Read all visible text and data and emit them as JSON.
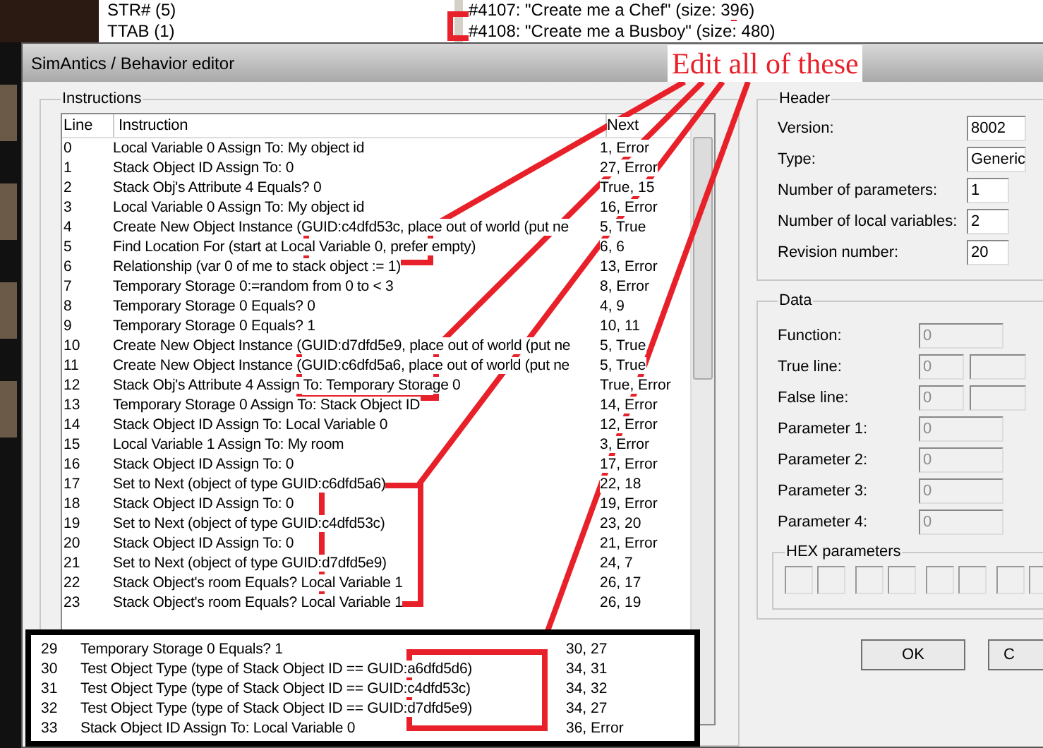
{
  "background_window": {
    "resource_list": [
      "STR# (5)",
      "TTAB (1)"
    ],
    "string_list": [
      "#4107: \"Create me a Chef\" (size: 396)",
      "#4108: \"Create me a Busboy\" (size: 480)"
    ]
  },
  "dialog": {
    "title": "SimAntics / Behavior editor"
  },
  "instructions": {
    "title": "Instructions",
    "columns": [
      "Line",
      "Instruction",
      "Next"
    ],
    "rows": [
      {
        "line": "0",
        "instruction": "Local Variable 0 Assign To: My object id",
        "next": "1, Error"
      },
      {
        "line": "1",
        "instruction": "Stack Object ID Assign To: 0",
        "next": "27, Error"
      },
      {
        "line": "2",
        "instruction": "Stack Obj's Attribute 4 Equals? 0",
        "next": "True, 15"
      },
      {
        "line": "3",
        "instruction": "Local Variable 0 Assign To: My object id",
        "next": "16, Error"
      },
      {
        "line": "4",
        "instruction": "Create New Object Instance (GUID:c4dfd53c, place out of world (put ne",
        "next": "5, True"
      },
      {
        "line": "5",
        "instruction": "Find Location For (start at Local Variable 0, prefer empty)",
        "next": "6, 6"
      },
      {
        "line": "6",
        "instruction": "Relationship (var 0 of me to stack object := 1)",
        "next": "13, Error"
      },
      {
        "line": "7",
        "instruction": "Temporary Storage 0:=random from 0 to < 3",
        "next": "8, Error"
      },
      {
        "line": "8",
        "instruction": "Temporary Storage 0 Equals? 0",
        "next": "4, 9"
      },
      {
        "line": "9",
        "instruction": "Temporary Storage 0 Equals? 1",
        "next": "10, 11"
      },
      {
        "line": "10",
        "instruction": "Create New Object Instance (GUID:d7dfd5e9, place out of world (put ne",
        "next": "5, True"
      },
      {
        "line": "11",
        "instruction": "Create New Object Instance (GUID:c6dfd5a6, place out of world (put ne",
        "next": "5, True"
      },
      {
        "line": "12",
        "instruction": "Stack Obj's Attribute 4 Assign To: Temporary Storage 0",
        "next": "True, Error"
      },
      {
        "line": "13",
        "instruction": "Temporary Storage 0 Assign To: Stack Object ID",
        "next": "14, Error"
      },
      {
        "line": "14",
        "instruction": "Stack Object ID Assign To: Local Variable 0",
        "next": "12, Error"
      },
      {
        "line": "15",
        "instruction": "Local Variable 1 Assign To: My room",
        "next": "3, Error"
      },
      {
        "line": "16",
        "instruction": "Stack Object ID Assign To: 0",
        "next": "17, Error"
      },
      {
        "line": "17",
        "instruction": "Set to Next (object of type GUID:c6dfd5a6)",
        "next": "22, 18"
      },
      {
        "line": "18",
        "instruction": "Stack Object ID Assign To: 0",
        "next": "19, Error"
      },
      {
        "line": "19",
        "instruction": "Set to Next (object of type GUID:c4dfd53c)",
        "next": "23, 20"
      },
      {
        "line": "20",
        "instruction": "Stack Object ID Assign To: 0",
        "next": "21, Error"
      },
      {
        "line": "21",
        "instruction": "Set to Next (object of type GUID:d7dfd5e9)",
        "next": "24, 7"
      },
      {
        "line": "22",
        "instruction": "Stack Object's room Equals? Local Variable 1",
        "next": "26, 17"
      },
      {
        "line": "23",
        "instruction": "Stack Object's room Equals? Local Variable 1",
        "next": "26, 19"
      }
    ]
  },
  "header": {
    "title": "Header",
    "fields": [
      {
        "label": "Version:",
        "value": "8002"
      },
      {
        "label": "Type:",
        "value": "Generic"
      },
      {
        "label": "Number of parameters:",
        "value": "1"
      },
      {
        "label": "Number of local variables:",
        "value": "2"
      },
      {
        "label": "Revision number:",
        "value": "20"
      }
    ]
  },
  "data": {
    "title": "Data",
    "disabled": true,
    "fields": [
      {
        "label": "Function:",
        "value": "0",
        "kind": "single"
      },
      {
        "label": "True line:",
        "value": "0",
        "kind": "pair"
      },
      {
        "label": "False line:",
        "value": "0",
        "kind": "pair"
      },
      {
        "label": "Parameter 1:",
        "value": "0",
        "kind": "single"
      },
      {
        "label": "Parameter 2:",
        "value": "0",
        "kind": "single"
      },
      {
        "label": "Parameter 3:",
        "value": "0",
        "kind": "single"
      },
      {
        "label": "Parameter 4:",
        "value": "0",
        "kind": "single"
      }
    ],
    "hex_title": "HEX parameters"
  },
  "buttons": [
    "OK",
    "C"
  ],
  "annotation": {
    "callout": "Edit all of these"
  },
  "inset": {
    "rows": [
      {
        "line": "29",
        "instruction": "Temporary Storage 0 Equals? 1",
        "next": "30, 27"
      },
      {
        "line": "30",
        "instruction": "Test Object Type (type of Stack Object ID == GUID:a6dfd5d6)",
        "next": "34, 31"
      },
      {
        "line": "31",
        "instruction": "Test Object Type (type of Stack Object ID == GUID:c4dfd53c)",
        "next": "34, 32"
      },
      {
        "line": "32",
        "instruction": "Test Object Type (type of Stack Object ID == GUID:d7dfd5e9)",
        "next": "34, 27"
      },
      {
        "line": "33",
        "instruction": "Stack Object ID Assign To: Local Variable 0",
        "next": "36, Error"
      }
    ]
  }
}
